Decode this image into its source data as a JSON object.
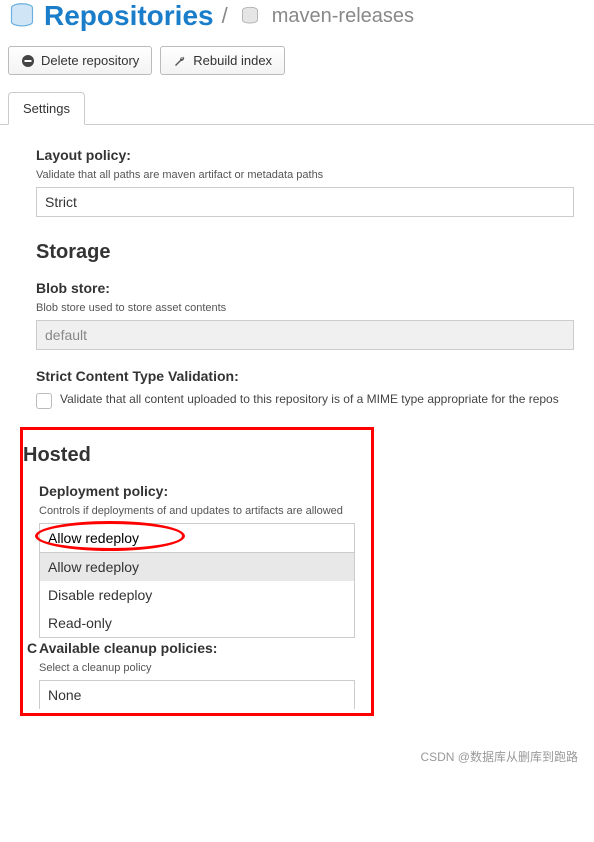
{
  "breadcrumb": {
    "main": "Repositories",
    "separator": "/",
    "sub": "maven-releases"
  },
  "toolbar": {
    "delete_label": "Delete repository",
    "rebuild_label": "Rebuild index"
  },
  "tabs": {
    "settings": "Settings"
  },
  "layout_policy": {
    "label": "Layout policy:",
    "help": "Validate that all paths are maven artifact or metadata paths",
    "value": "Strict"
  },
  "storage": {
    "heading": "Storage",
    "blob_store": {
      "label": "Blob store:",
      "help": "Blob store used to store asset contents",
      "value": "default"
    },
    "strict_validation": {
      "label": "Strict Content Type Validation:",
      "checkbox_text": "Validate that all content uploaded to this repository is of a MIME type appropriate for the repos"
    }
  },
  "hosted": {
    "heading": "Hosted",
    "deployment_policy": {
      "label": "Deployment policy:",
      "help": "Controls if deployments of and updates to artifacts are allowed",
      "value": "Allow redeploy",
      "options": [
        "Allow redeploy",
        "Disable redeploy",
        "Read-only"
      ]
    },
    "cleanup_letter": "C",
    "cleanup": {
      "label": "Available cleanup policies:",
      "help": "Select a cleanup policy",
      "value": "None"
    }
  },
  "watermark": "CSDN @数据库从删库到跑路"
}
